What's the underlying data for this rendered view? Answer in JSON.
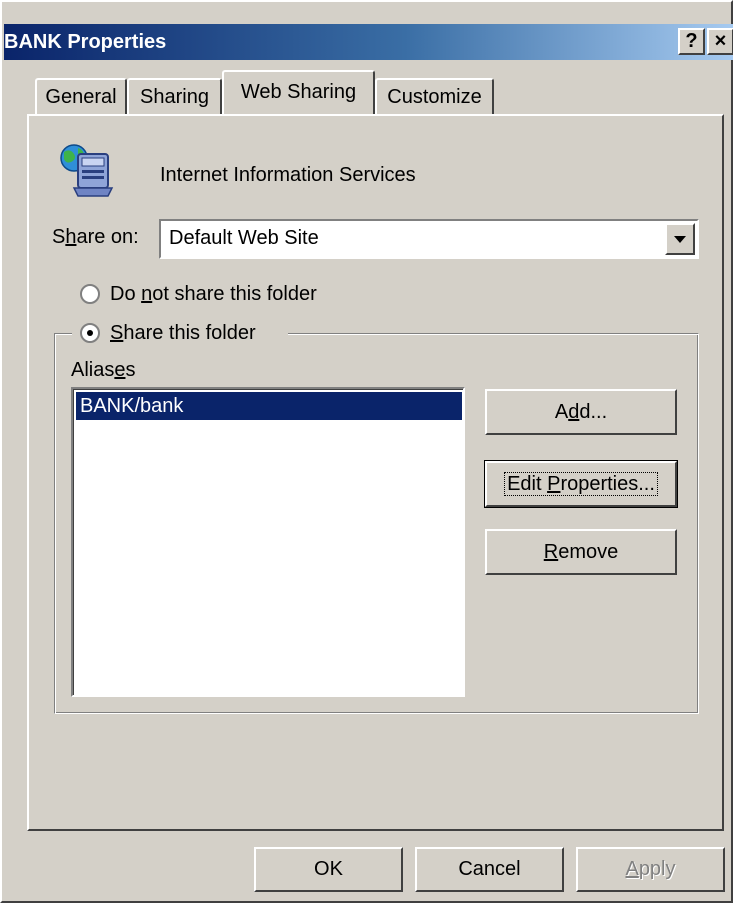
{
  "window": {
    "title": "BANK Properties",
    "help_glyph": "?",
    "close_glyph": "×"
  },
  "tabs": [
    {
      "label": "General",
      "active": false
    },
    {
      "label": "Sharing",
      "active": false
    },
    {
      "label": "Web Sharing",
      "active": true
    },
    {
      "label": "Customize",
      "active": false
    }
  ],
  "web_sharing": {
    "service_name": "Internet Information Services",
    "share_on_label": {
      "pre": "S",
      "key": "h",
      "post": "are on:"
    },
    "share_on_value": "Default Web Site",
    "radio_do_not_share": {
      "pre": "Do ",
      "key": "n",
      "post": "ot share this folder",
      "checked": false
    },
    "radio_share": {
      "pre": "",
      "key": "S",
      "post": "hare this folder",
      "checked": true
    },
    "aliases_label": {
      "pre": "Alias",
      "key": "e",
      "post": "s"
    },
    "aliases": [
      "BANK/bank"
    ],
    "selected_alias_index": 0,
    "add_button": {
      "pre": "A",
      "key": "d",
      "post": "d..."
    },
    "edit_button": {
      "pre": "Edit ",
      "key": "P",
      "post": "roperties..."
    },
    "remove_button": {
      "pre": "",
      "key": "R",
      "post": "emove"
    }
  },
  "footer": {
    "ok_label": "OK",
    "cancel_label": "Cancel",
    "apply_label": {
      "pre": "",
      "key": "A",
      "post": "pply"
    },
    "apply_enabled": false
  },
  "colors": {
    "titlebar_start": "#0a246a",
    "titlebar_end": "#a6caf0",
    "dialog_face": "#d4d0c8",
    "selection": "#0a246a"
  }
}
